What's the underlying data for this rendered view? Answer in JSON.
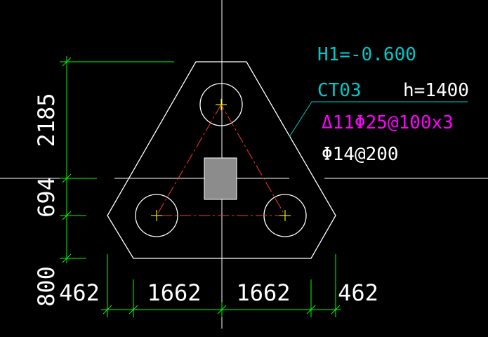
{
  "colors": {
    "background": "#000000",
    "outline": "#ffffff",
    "dimension": "#00ff00",
    "leader": "#00c8c8",
    "elevation_text": "#00c8c8",
    "rebar_text": "#ff00ff",
    "rebar_lines": "#ff3333",
    "column_fill": "#8c8c8c",
    "center_mark": "#e6e600"
  },
  "annotations": {
    "elevation": "H1=-0.600",
    "cap_id": "CT03",
    "cap_height": "h=1400",
    "main_rebar": "Δ11Φ25@100x3",
    "dist_rebar": "Φ14@200"
  },
  "dimensions": {
    "vertical": [
      "2185",
      "694",
      "800"
    ],
    "horizontal": [
      "462",
      "1662",
      "1662",
      "462"
    ]
  },
  "pile_count": 3,
  "icons": [
    "pile-circle",
    "column-rect",
    "center-cross"
  ]
}
